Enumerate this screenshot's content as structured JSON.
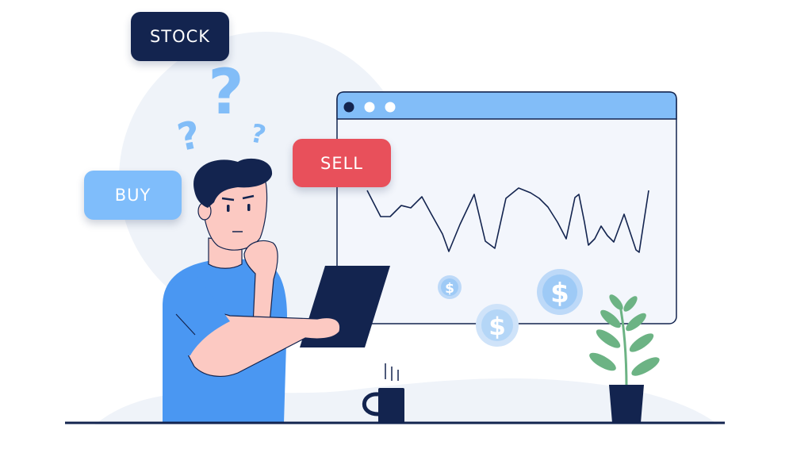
{
  "labels": {
    "stock": "STOCK",
    "sell": "SELL",
    "buy": "BUY"
  },
  "colors": {
    "navy": "#13244f",
    "sell_red": "#e8505b",
    "buy_blue": "#7fbdfb",
    "shirt_blue": "#4a97f2",
    "skin": "#fcc9c2",
    "panel_bg": "#f3f6fc",
    "window_bar": "#82bdf8",
    "plant_green": "#6cb384",
    "coin_blue": "#bdd9f8"
  },
  "icons": [
    "question-mark-icon",
    "dollar-coin-icon",
    "browser-dot-icon"
  ]
}
